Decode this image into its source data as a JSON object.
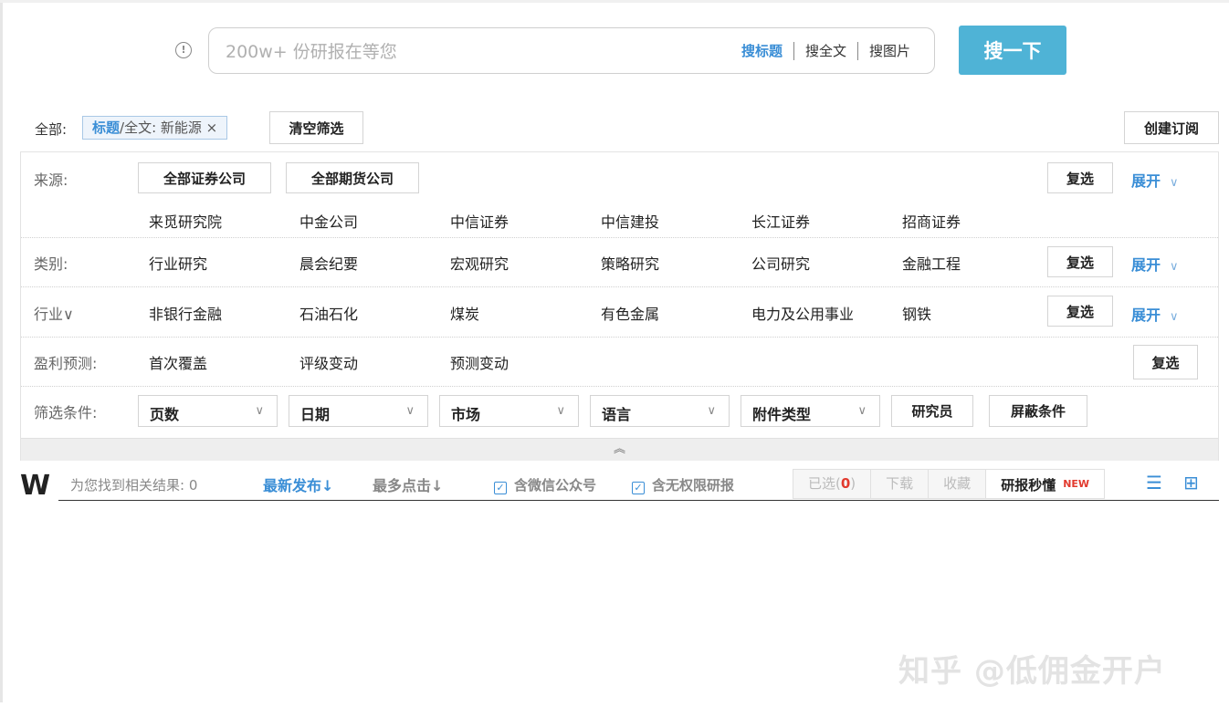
{
  "search": {
    "placeholder": "200w+ 份研报在等您",
    "modes": [
      "搜标题",
      "搜全文",
      "搜图片"
    ],
    "active_mode": "搜标题",
    "button": "搜一下",
    "info_glyph": "!"
  },
  "filter_header": {
    "all_label": "全部:",
    "tag_field": "标题",
    "tag_rest": "/全文: 新能源 ×",
    "clear_button": "清空筛选",
    "subscribe_button": "创建订阅"
  },
  "rows": {
    "source": {
      "label": "来源:",
      "buttons": [
        "全部证券公司",
        "全部期货公司"
      ],
      "items": [
        "来觅研究院",
        "中金公司",
        "中信证券",
        "中信建投",
        "长江证券",
        "招商证券"
      ]
    },
    "category": {
      "label": "类别:",
      "items": [
        "行业研究",
        "晨会纪要",
        "宏观研究",
        "策略研究",
        "公司研究",
        "金融工程"
      ]
    },
    "industry": {
      "label": "行业∨",
      "items": [
        "非银行金融",
        "石油石化",
        "煤炭",
        "有色金属",
        "电力及公用事业",
        "钢铁"
      ]
    },
    "profit": {
      "label": "盈利预测:",
      "items": [
        "首次覆盖",
        "评级变动",
        "预测变动"
      ]
    },
    "conditions": {
      "label": "筛选条件:",
      "dropdowns": [
        "页数",
        "日期",
        "市场",
        "语言",
        "附件类型"
      ],
      "buttons": [
        "研究员",
        "屏蔽条件"
      ]
    }
  },
  "common": {
    "multi_select": "复选",
    "expand": "展开",
    "chevron_down": "∨",
    "collapse_glyph": "︽"
  },
  "results": {
    "logo": "W",
    "count_text": "为您找到相关结果: 0",
    "sort_latest": "最新发布↓",
    "sort_clicks": "最多点击↓",
    "check_wechat": "含微信公众号",
    "check_unlimited": "含无权限研报",
    "check_mark": "✓",
    "selected_label": "已选(",
    "selected_count": "0",
    "selected_close": ")",
    "download": "下载",
    "favorite": "收藏",
    "feature": "研报秒懂",
    "new_badge": "NEW",
    "list_view_glyph": "☰",
    "grid_view_glyph": "⊞"
  },
  "watermark": "知乎 @低佣金开户"
}
